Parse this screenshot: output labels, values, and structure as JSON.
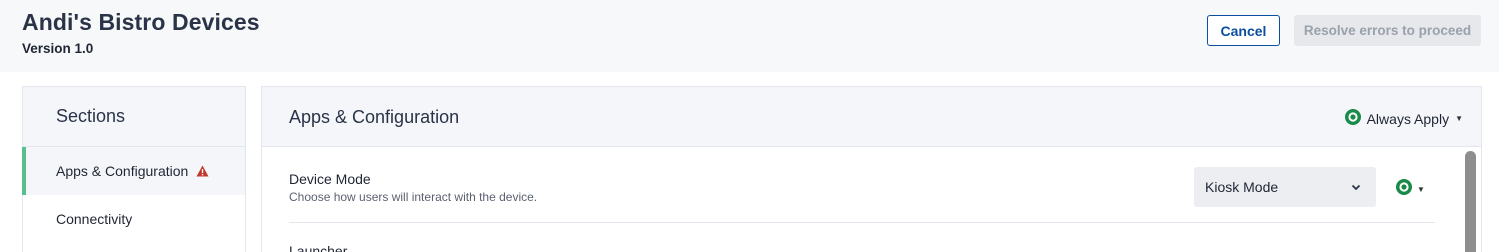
{
  "header": {
    "title": "Andi's Bistro Devices",
    "version": "Version 1.0",
    "cancel_label": "Cancel",
    "resolve_label": "Resolve errors to proceed"
  },
  "sidebar": {
    "heading": "Sections",
    "items": [
      {
        "label": "Apps & Configuration",
        "active": true,
        "icon": "warning-icon"
      },
      {
        "label": "Connectivity",
        "active": false
      }
    ]
  },
  "panel": {
    "title": "Apps & Configuration",
    "apply_mode": "Always Apply",
    "settings": [
      {
        "name": "Device Mode",
        "description": "Choose how users will interact with the device.",
        "value": "Kiosk Mode"
      }
    ],
    "next_setting_label": "Launcher"
  },
  "colors": {
    "accent": "#0b4fa0",
    "status_green": "#1a8a4a",
    "active_indicator": "#57bf90",
    "warning": "#c0392b"
  }
}
